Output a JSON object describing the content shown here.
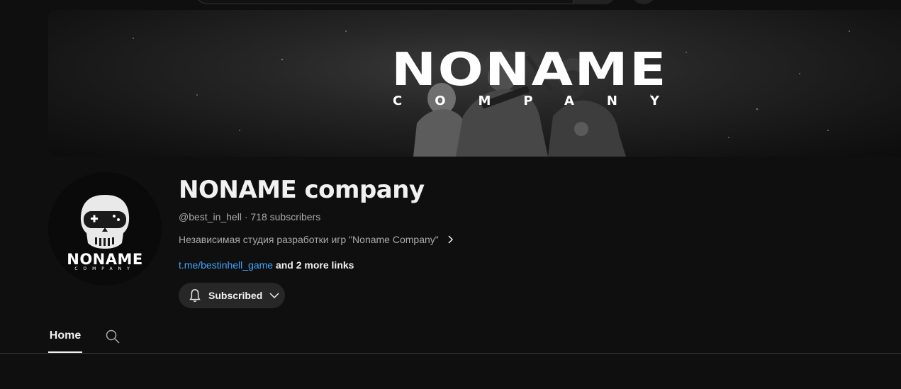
{
  "banner": {
    "title": "NONAME",
    "subtitle": "COMPANY"
  },
  "avatar": {
    "logo_text": "NONAME",
    "logo_sub": "COMPANY"
  },
  "channel": {
    "name": "NONAME company",
    "handle": "@best_in_hell",
    "separator": " · ",
    "subscribers": "718 subscribers",
    "description": "Независимая студия разработки игр \"Noname Company\"",
    "link_text": "t.me/bestinhell_game",
    "more_links": " and 2 more links"
  },
  "subscribe_button": {
    "label": "Subscribed"
  },
  "tabs": {
    "home": "Home"
  },
  "icons": {
    "bell": "bell-icon",
    "chevron_down": "chevron-down-icon",
    "chevron_right": "chevron-right-icon",
    "search": "search-icon"
  },
  "colors": {
    "background": "#0f0f0f",
    "link": "#3ea6ff",
    "button_bg": "#272727",
    "muted_text": "#aaaaaa"
  }
}
